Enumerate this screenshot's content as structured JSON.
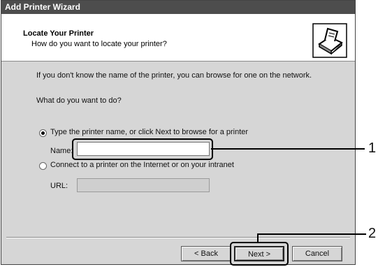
{
  "window": {
    "title": "Add Printer Wizard"
  },
  "header": {
    "title": "Locate Your Printer",
    "subtitle": "How do you want to locate your printer?",
    "icon": "printer-icon"
  },
  "body": {
    "intro": "If you don't know the name of the printer, you can browse for one on the network.",
    "question": "What do you want to do?",
    "option_type": {
      "label": "Type the printer name, or click Next to browse for a printer",
      "selected": true,
      "field_label": "Name:",
      "field_value": ""
    },
    "option_internet": {
      "label": "Connect to a printer on the Internet or on your intranet",
      "selected": false,
      "field_label": "URL:",
      "field_value": ""
    }
  },
  "buttons": {
    "back": "< Back",
    "next": "Next >",
    "cancel": "Cancel"
  },
  "callouts": [
    "1",
    "2"
  ]
}
